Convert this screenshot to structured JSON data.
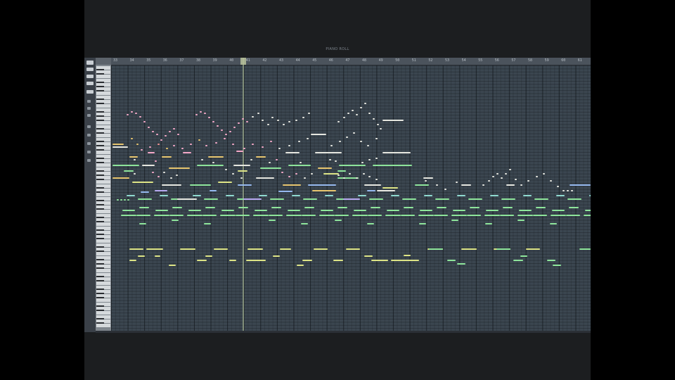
{
  "window": {
    "title": "PIANO ROLL"
  },
  "toolbar": {
    "icons": [
      "menu-icon",
      "snap-icon",
      "draw-icon",
      "tool-icon",
      "zoom-icon",
      "select-icon",
      "stamp-icon",
      "mute-icon",
      "slice-icon",
      "play-icon",
      "target-icon"
    ]
  },
  "timeline": {
    "bars": [
      "33",
      "34",
      "35",
      "36",
      "37",
      "38",
      "39",
      "40",
      "41",
      "42",
      "43",
      "44",
      "45",
      "46",
      "47",
      "48",
      "49",
      "50",
      "51",
      "52",
      "53",
      "54",
      "55",
      "56",
      "57",
      "58",
      "59",
      "60",
      "61"
    ]
  },
  "colors": {
    "background": "#1c1e20",
    "grid": "#3b4650",
    "toolbar": "#3a4048",
    "timeline": "#4b535c",
    "playhead": "#9aa88a",
    "note_colors": [
      "#8ee59b",
      "#dde486",
      "#f4a8c8",
      "#e6e7e0",
      "#e6c46e",
      "#95b8ee",
      "#b6a9f0",
      "#8fd9cf",
      "#ef8f8f"
    ]
  }
}
